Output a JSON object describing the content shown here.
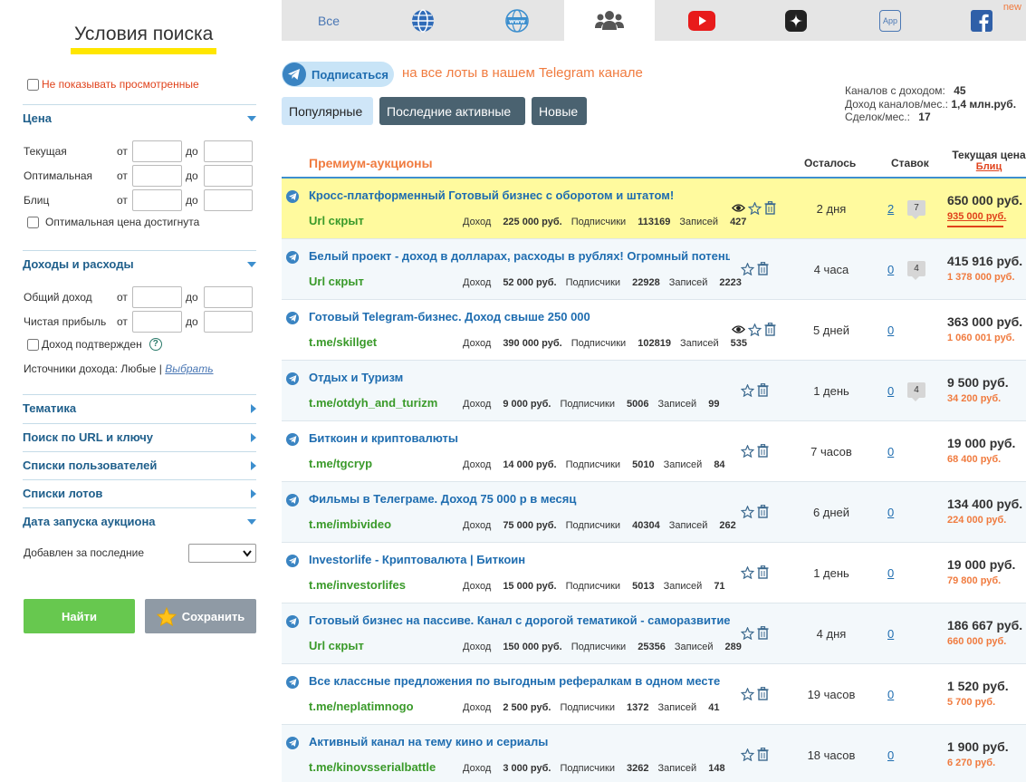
{
  "sidebar": {
    "title": "Условия поиска",
    "hide_viewed": "Не показывать просмотренные",
    "sections": {
      "price": "Цена",
      "income": "Доходы и расходы",
      "theme": "Тематика",
      "search_url": "Поиск по URL и ключу",
      "user_lists": "Списки пользователей",
      "lot_lists": "Списки лотов",
      "launch_date": "Дата запуска аукциона"
    },
    "price_rows": [
      "Текущая",
      "Оптимальная",
      "Блиц"
    ],
    "income_rows": [
      "Общий доход",
      "Чистая прибыль"
    ],
    "from": "от",
    "to": "до",
    "optimal_reached": "Оптимальная цена достигнута",
    "income_confirmed": "Доход подтвержден",
    "help": "?",
    "income_sources_label": "Источники дохода: Любые |",
    "income_sources_link": "Выбрать",
    "added_label": "Добавлен за последние",
    "find_btn": "Найти",
    "save_btn": "Сохранить"
  },
  "tabs": {
    "all": "Все",
    "app": "App",
    "new_badge": "new"
  },
  "telegram": {
    "subscribe": "Подписаться",
    "text": "на все лоты в нашем Telegram канале"
  },
  "sort": [
    "Популярные",
    "Последние активные",
    "Новые"
  ],
  "stats": {
    "channels_label": "Каналов с доходом:",
    "channels_value": "45",
    "income_label": "Доход каналов/мес.:",
    "income_value": "1,4 млн.руб.",
    "deals_label": "Сделок/мес.:",
    "deals_value": "17"
  },
  "table": {
    "title": "Премиум-аукционы",
    "col_left": "Осталось",
    "col_bids": "Ставок",
    "col_price": "Текущая цена",
    "col_blitz": "Блиц",
    "rows": [
      {
        "title": "Кросс-платформенный Готовый бизнес с оборотом и штатом!",
        "url": "Url скрыт",
        "income": "225 000 руб.",
        "subs": "113169",
        "posts": "427",
        "left": "2 дня",
        "bids": "2",
        "comments": "7",
        "price": "650 000 руб.",
        "blitz": "935 000 руб."
      },
      {
        "title": "Белый проект - доход в долларах, расходы в рублях! Огромный потенциал",
        "url": "Url скрыт",
        "income": "52 000 руб.",
        "subs": "22928",
        "posts": "2223",
        "left": "4 часа",
        "bids": "0",
        "comments": "4",
        "price": "415 916 руб.",
        "blitz": "1 378 000 руб."
      },
      {
        "title": "Готовый Telegram-бизнес. Доход свыше 250 000",
        "url": "t.me/skillget",
        "income": "390 000 руб.",
        "subs": "102819",
        "posts": "535",
        "left": "5 дней",
        "bids": "0",
        "comments": "",
        "price": "363 000 руб.",
        "blitz": "1 060 001 руб."
      },
      {
        "title": "Отдых и Туризм",
        "url": "t.me/otdyh_and_turizm",
        "income": "9 000 руб.",
        "subs": "5006",
        "posts": "99",
        "left": "1 день",
        "bids": "0",
        "comments": "4",
        "price": "9 500 руб.",
        "blitz": "34 200 руб."
      },
      {
        "title": "Биткоин и криптовалюты",
        "url": "t.me/tgcryp",
        "income": "14 000 руб.",
        "subs": "5010",
        "posts": "84",
        "left": "7 часов",
        "bids": "0",
        "comments": "",
        "price": "19 000 руб.",
        "blitz": "68 400 руб."
      },
      {
        "title": "Фильмы в Телеграме. Доход 75 000 р в месяц",
        "url": "t.me/imbivideo",
        "income": "75 000 руб.",
        "subs": "40304",
        "posts": "262",
        "left": "6 дней",
        "bids": "0",
        "comments": "",
        "price": "134 400 руб.",
        "blitz": "224 000 руб."
      },
      {
        "title": "Investorlife - Криптовалюта | Биткоин",
        "url": "t.me/investorlifes",
        "income": "15 000 руб.",
        "subs": "5013",
        "posts": "71",
        "left": "1 день",
        "bids": "0",
        "comments": "",
        "price": "19 000 руб.",
        "blitz": "79 800 руб."
      },
      {
        "title": "Готовый бизнес на пассиве. Канал с дорогой тематикой - саморазвитие",
        "url": "Url скрыт",
        "income": "150 000 руб.",
        "subs": "25356",
        "posts": "289",
        "left": "4 дня",
        "bids": "0",
        "comments": "",
        "price": "186 667 руб.",
        "blitz": "660 000 руб."
      },
      {
        "title": "Все классные предложения по выгодным рефералкам в одном месте",
        "url": "t.me/neplatimnogo",
        "income": "2 500 руб.",
        "subs": "1372",
        "posts": "41",
        "left": "19 часов",
        "bids": "0",
        "comments": "",
        "price": "1 520 руб.",
        "blitz": "5 700 руб."
      },
      {
        "title": "Активный канал на тему кино и сериалы",
        "url": "t.me/kinovsserialbattle",
        "income": "3 000 руб.",
        "subs": "3262",
        "posts": "148",
        "left": "18 часов",
        "bids": "0",
        "comments": "",
        "price": "1 900 руб.",
        "blitz": "6 270 руб."
      }
    ],
    "income_label": "Доход",
    "subs_label": "Подписчики",
    "posts_label": "Записей"
  }
}
